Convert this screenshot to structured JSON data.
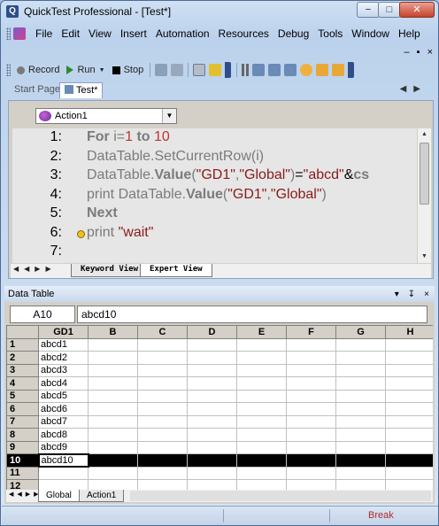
{
  "window": {
    "title": "QuickTest Professional - [Test*]",
    "controls": {
      "minimize": "−",
      "maximize": "□",
      "close": "✕"
    },
    "app_icon": "Q"
  },
  "menubar": {
    "items": [
      "File",
      "Edit",
      "View",
      "Insert",
      "Automation",
      "Resources",
      "Debug",
      "Tools",
      "Window",
      "Help"
    ],
    "mdi_controls": [
      "–",
      "▪",
      "×"
    ]
  },
  "toolbar": {
    "record": "Record",
    "run": "Run",
    "stop": "Stop"
  },
  "document_tabs": {
    "start_page": "Start Page",
    "test": "Test*"
  },
  "editor": {
    "action": "Action1",
    "lines": [
      {
        "n": "1:",
        "tokens": [
          [
            "kw",
            "For "
          ],
          [
            "gr",
            "i="
          ],
          [
            "nm",
            "1"
          ],
          [
            "kw",
            " to "
          ],
          [
            "nm",
            "10"
          ]
        ]
      },
      {
        "n": "2:",
        "tokens": [
          [
            "gr",
            "DataTable.SetCurrentRow(i)"
          ]
        ]
      },
      {
        "n": "3:",
        "tokens": [
          [
            "gr",
            "DataTable."
          ],
          [
            "kw",
            "Value"
          ],
          [
            "gr",
            "("
          ],
          [
            "st",
            "\"GD1\""
          ],
          [
            "gr",
            ","
          ],
          [
            "st",
            "\"Global\""
          ],
          [
            "gr",
            ")"
          ],
          [
            "op",
            "="
          ],
          [
            "st",
            "\"abcd\""
          ],
          [
            "op",
            "&"
          ],
          [
            "kw",
            "cs"
          ]
        ]
      },
      {
        "n": "4:",
        "tokens": [
          [
            "gr",
            "print DataTable."
          ],
          [
            "kw",
            "Value"
          ],
          [
            "gr",
            "("
          ],
          [
            "st",
            "\"GD1\""
          ],
          [
            "gr",
            ","
          ],
          [
            "st",
            "\"Global\""
          ],
          [
            "gr",
            ")"
          ]
        ]
      },
      {
        "n": "5:",
        "tokens": [
          [
            "kw",
            "Next"
          ]
        ]
      },
      {
        "n": "6:",
        "tokens": [
          [
            "gr",
            "print "
          ],
          [
            "st",
            "\"wait\""
          ]
        ]
      },
      {
        "n": "7:",
        "tokens": []
      }
    ],
    "current_line": 6,
    "view_tabs": {
      "keyword": "Keyword View",
      "expert": "Expert View"
    }
  },
  "data_table": {
    "panel_title": "Data Table",
    "panel_controls": [
      "▾",
      "↧",
      "×"
    ],
    "cell_ref": "A10",
    "cell_value": "abcd10",
    "columns": [
      "GD1",
      "B",
      "C",
      "D",
      "E",
      "F",
      "G",
      "H"
    ],
    "rows": [
      {
        "n": "1",
        "v": "abcd1"
      },
      {
        "n": "2",
        "v": "abcd2"
      },
      {
        "n": "3",
        "v": "abcd3"
      },
      {
        "n": "4",
        "v": "abcd4"
      },
      {
        "n": "5",
        "v": "abcd5"
      },
      {
        "n": "6",
        "v": "abcd6"
      },
      {
        "n": "7",
        "v": "abcd7"
      },
      {
        "n": "8",
        "v": "abcd8"
      },
      {
        "n": "9",
        "v": "abcd9"
      },
      {
        "n": "10",
        "v": "abcd10"
      },
      {
        "n": "11",
        "v": ""
      },
      {
        "n": "12",
        "v": ""
      }
    ],
    "selected_row": "10",
    "sheet_tabs": [
      "Global",
      "Action1"
    ],
    "active_sheet": "Global"
  },
  "statusbar": {
    "mode": "Break"
  }
}
